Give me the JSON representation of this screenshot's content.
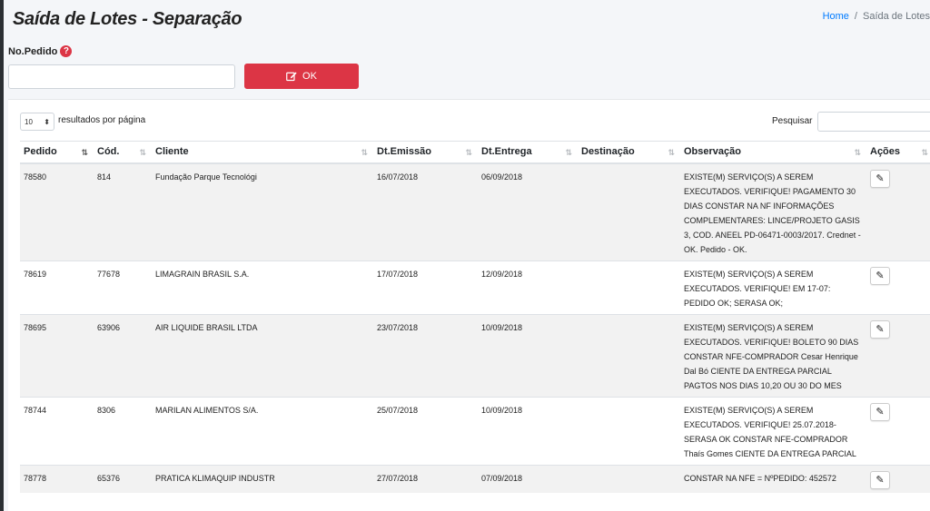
{
  "header": {
    "title": "Saída de Lotes - Separação",
    "breadcrumb": {
      "home": "Home",
      "separator": "/",
      "current": "Saída de Lotes"
    }
  },
  "form": {
    "label": "No.Pedido",
    "help_glyph": "?",
    "input_value": "",
    "ok_label": "OK"
  },
  "table_controls": {
    "page_length": "10",
    "page_length_suffix": "resultados por página",
    "search_label": "Pesquisar",
    "search_value": ""
  },
  "columns": [
    "Pedido",
    "Cód.",
    "Cliente",
    "Dt.Emissão",
    "Dt.Entrega",
    "Destinação",
    "Observação",
    "Ações"
  ],
  "rows": [
    {
      "pedido": "78580",
      "cod": "814",
      "cliente": "Fundação Parque Tecnológi",
      "emissao": "16/07/2018",
      "entrega": "06/09/2018",
      "destinacao": "",
      "observacao": "EXISTE(M) SERVIÇO(S) A SEREM EXECUTADOS. VERIFIQUE! PAGAMENTO 30 DIAS CONSTAR NA NF INFORMAÇÕES COMPLEMENTARES: LINCE/PROJETO GASIS 3, COD. ANEEL PD-06471-0003/2017. Crednet - OK. Pedido - OK."
    },
    {
      "pedido": "78619",
      "cod": "77678",
      "cliente": "LIMAGRAIN BRASIL S.A.",
      "emissao": "17/07/2018",
      "entrega": "12/09/2018",
      "destinacao": "",
      "observacao": "EXISTE(M) SERVIÇO(S) A SEREM EXECUTADOS. VERIFIQUE! EM 17-07: PEDIDO OK; SERASA OK;"
    },
    {
      "pedido": "78695",
      "cod": "63906",
      "cliente": "AIR LIQUIDE BRASIL LTDA",
      "emissao": "23/07/2018",
      "entrega": "10/09/2018",
      "destinacao": "",
      "observacao": "EXISTE(M) SERVIÇO(S) A SEREM EXECUTADOS. VERIFIQUE! BOLETO 90 DIAS CONSTAR NFE-COMPRADOR Cesar Henrique Dal Bó CIENTE DA ENTREGA PARCIAL PAGTOS NOS DIAS 10,20 OU 30 DO MES"
    },
    {
      "pedido": "78744",
      "cod": "8306",
      "cliente": "MARILAN ALIMENTOS S/A.",
      "emissao": "25/07/2018",
      "entrega": "10/09/2018",
      "destinacao": "",
      "observacao": "EXISTE(M) SERVIÇO(S) A SEREM EXECUTADOS. VERIFIQUE! 25.07.2018-SERASA OK CONSTAR NFE-COMPRADOR Thaís Gomes CIENTE DA ENTREGA PARCIAL"
    },
    {
      "pedido": "78778",
      "cod": "65376",
      "cliente": "PRATICA KLIMAQUIP INDUSTR",
      "emissao": "27/07/2018",
      "entrega": "07/09/2018",
      "destinacao": "",
      "observacao": "CONSTAR NA NFE = NºPEDIDO: 452572"
    }
  ],
  "icons": {
    "edit": "edit-icon",
    "help": "help-icon",
    "sort": "sort-icon"
  },
  "colors": {
    "accent_red": "#dc3545",
    "link_blue": "#007bff",
    "row_stripe": "#f2f2f2"
  }
}
